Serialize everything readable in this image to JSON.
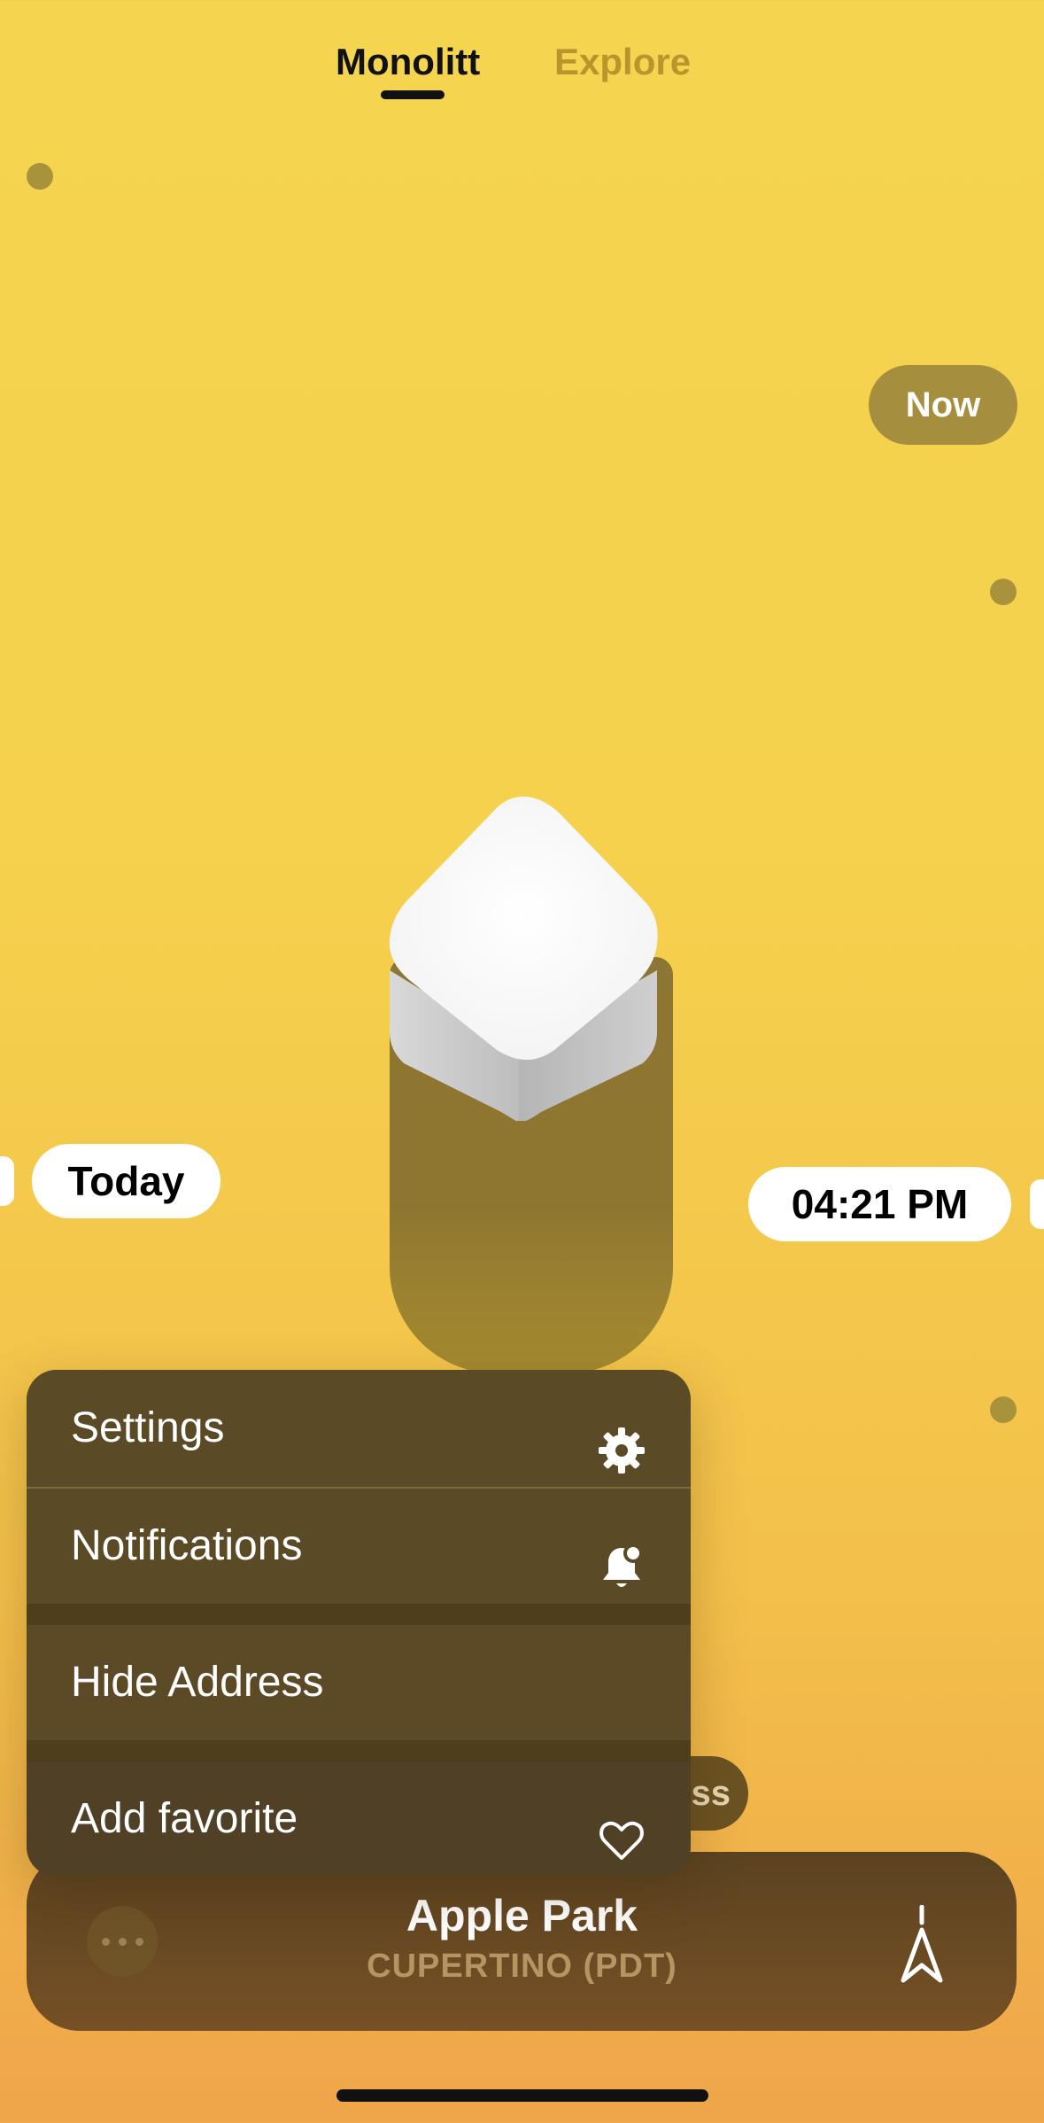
{
  "tabs": {
    "active_label": "Monolitt",
    "inactive_label": "Explore"
  },
  "timeline": {
    "now_label": "Now",
    "today_label": "Today",
    "time_label": "04:21 PM",
    "partial_label": "ss"
  },
  "menu": {
    "items": [
      {
        "label": "Settings",
        "icon": "gear-icon"
      },
      {
        "label": "Notifications",
        "icon": "bell-badge-icon"
      },
      {
        "label": "Hide Address",
        "icon": ""
      },
      {
        "label": "Add favorite",
        "icon": "heart-icon"
      }
    ]
  },
  "location": {
    "title": "Apple Park",
    "subtitle": "CUPERTINO (PDT)",
    "more_icon": "ellipsis-icon",
    "direction_icon": "compass-arrow-icon"
  },
  "colors": {
    "background_top": "#f5d44f",
    "background_bottom": "#efa54a",
    "menu_bg": "#5a4824",
    "pill_bg": "#ffffff"
  }
}
